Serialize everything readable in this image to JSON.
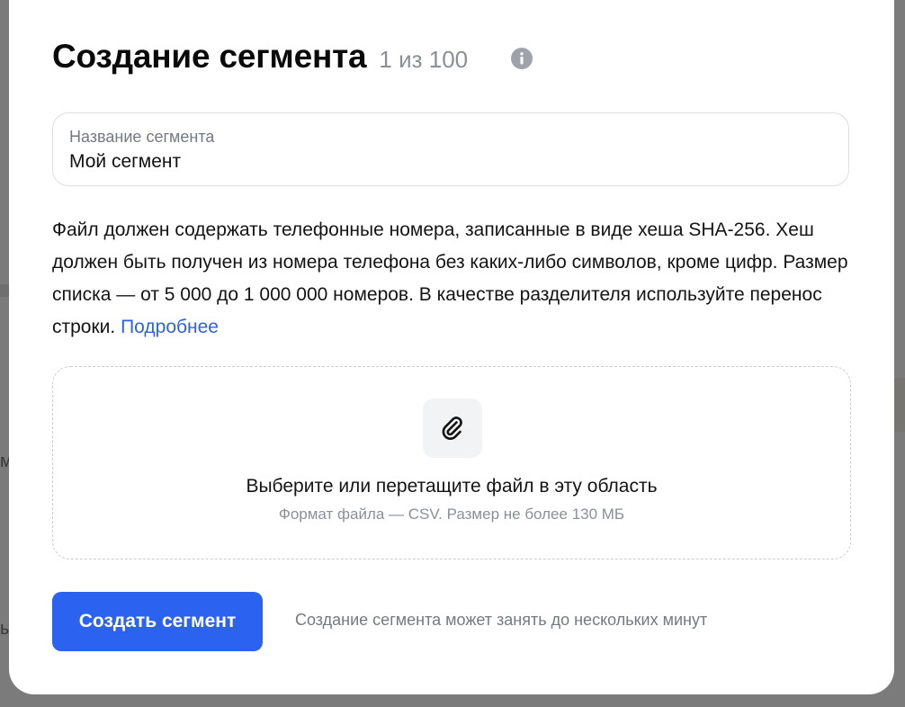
{
  "modal": {
    "title": "Создание сегмента",
    "counter": "1 из 100",
    "close_icon": "close-icon",
    "info_icon": "info-icon"
  },
  "name_field": {
    "label": "Название сегмента",
    "value": "Мой сегмент"
  },
  "description": {
    "text": "Файл должен содержать телефонные номера, записанные в виде хеша SHA-256. Хеш должен быть получен из номера телефона без каких-либо символов, кроме цифр. Размер списка — от 5 000 до 1 000 000 номеров. В качестве разделителя используйте перенос строки.",
    "link": "Подробнее"
  },
  "dropzone": {
    "icon": "paperclip-icon",
    "title": "Выберите или перетащите файл в эту область",
    "hint": "Формат файла — CSV. Размер не более 130 МБ"
  },
  "actions": {
    "create_label": "Создать сегмент",
    "note": "Создание сегмента может занять до нескольких минут"
  },
  "colors": {
    "accent": "#2b63f0",
    "overlay": "#7b7b7b"
  }
}
